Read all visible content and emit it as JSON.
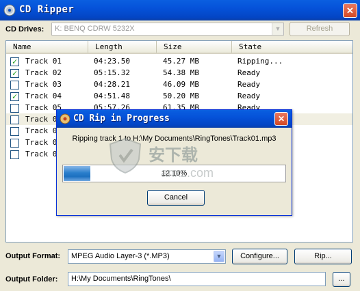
{
  "window": {
    "title": "CD Ripper",
    "close_glyph": "✕"
  },
  "drives": {
    "label": "CD Drives:",
    "selected": "K: BENQ CDRW 5232X",
    "refresh_label": "Refresh"
  },
  "list": {
    "columns": [
      "Name",
      "Length",
      "Size",
      "State"
    ],
    "rows": [
      {
        "checked": true,
        "name": "Track 01",
        "length": "04:23.50",
        "size": "45.27 MB",
        "state": "Ripping..."
      },
      {
        "checked": true,
        "name": "Track 02",
        "length": "05:15.32",
        "size": "54.38 MB",
        "state": "Ready"
      },
      {
        "checked": false,
        "name": "Track 03",
        "length": "04:28.21",
        "size": "46.09 MB",
        "state": "Ready"
      },
      {
        "checked": true,
        "name": "Track 04",
        "length": "04:51.48",
        "size": "50.20 MB",
        "state": "Ready"
      },
      {
        "checked": false,
        "name": "Track 05",
        "length": "05:57.26",
        "size": "61.35 MB",
        "state": "Ready"
      },
      {
        "checked": false,
        "name": "Track 06",
        "length": "",
        "size": "",
        "state": ""
      },
      {
        "checked": false,
        "name": "Track 07",
        "length": "",
        "size": "",
        "state": ""
      },
      {
        "checked": false,
        "name": "Track 08",
        "length": "",
        "size": "",
        "state": ""
      },
      {
        "checked": false,
        "name": "Track 09",
        "length": "",
        "size": "",
        "state": ""
      }
    ]
  },
  "output": {
    "format_label": "Output Format:",
    "format_value": "MPEG Audio Layer-3 (*.MP3)",
    "configure_label": "Configure...",
    "rip_label": "Rip...",
    "folder_label": "Output Folder:",
    "folder_value": "H:\\My Documents\\RingTones\\",
    "browse_label": "..."
  },
  "dialog": {
    "title": "CD Rip in Progress",
    "close_glyph": "✕",
    "message": "Ripping track 1 to H:\\My Documents\\RingTones\\Track01.mp3",
    "progress_percent": 12.1,
    "progress_label": "12.10%",
    "cancel_label": "Cancel"
  },
  "watermark": {
    "text": "安下载",
    "subtext": "anxz.com"
  }
}
